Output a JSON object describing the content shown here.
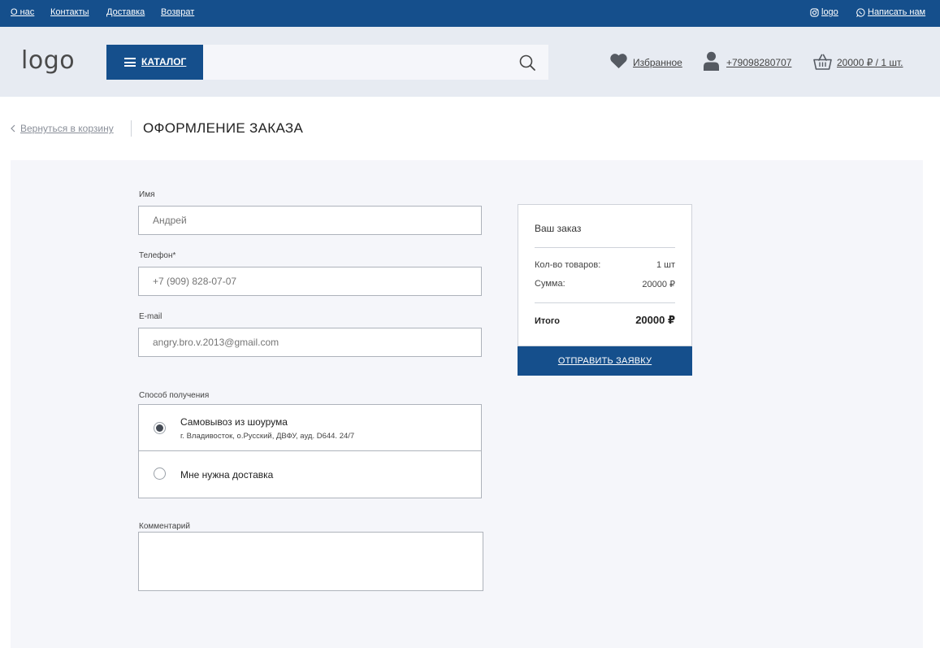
{
  "topbar": {
    "links": [
      "О нас",
      "Контакты",
      "Доставка",
      "Возврат"
    ],
    "instagram_label": "logo",
    "whatsapp_label": "Написать нам"
  },
  "header": {
    "logo": "logo",
    "catalog_label": "КАТАЛОГ",
    "search_value": "",
    "favorites_label": "Избранное",
    "phone": "+79098280707",
    "cart_label": "20000 ₽ / 1 шт."
  },
  "breadcrumb": {
    "back_label": "Вернуться в корзину",
    "title": "ОФОРМЛЕНИЕ ЗАКАЗА"
  },
  "form": {
    "name_label": "Имя",
    "name_placeholder": "Андрей",
    "phone_label": "Телефон*",
    "phone_placeholder": "+7 (909) 828-07-07",
    "email_label": "E-mail",
    "email_placeholder": "angry.bro.v.2013@gmail.com",
    "delivery_label": "Способ получения",
    "delivery_options": [
      {
        "title": "Самовывоз из шоурума",
        "subtitle": "г. Владивосток, о.Русский, ДВФУ, ауд. D644. 24/7",
        "checked": true
      },
      {
        "title": "Мне нужна доставка",
        "subtitle": "",
        "checked": false
      }
    ],
    "comment_label": "Комментарий",
    "comment_value": ""
  },
  "summary": {
    "title": "Ваш заказ",
    "count_label": "Кол-во товаров:",
    "count_value": "1 шт",
    "sum_label": "Сумма:",
    "sum_value": "20000 ₽",
    "total_label": "Итого",
    "total_value": "20000 ₽",
    "submit_label": "ОТПРАВИТЬ ЗАЯВКУ"
  },
  "colors": {
    "primary": "#154f8c",
    "header_bg": "#e7ebf2",
    "panel_bg": "#f5f6fa"
  }
}
